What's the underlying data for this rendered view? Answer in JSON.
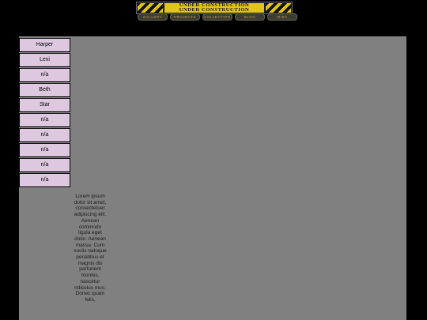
{
  "banner": {
    "line1": "UNDER CONSTRUCTION",
    "line2": "UNDER CONSTRUCTION"
  },
  "nav": [
    {
      "label": "GALLERY"
    },
    {
      "label": "PROJECTS"
    },
    {
      "label": "COLLECTION"
    },
    {
      "label": "BLOG"
    },
    {
      "label": "MISC"
    }
  ],
  "sidebar": {
    "items": [
      {
        "label": "Harper"
      },
      {
        "label": "Lexi"
      },
      {
        "label": "n/a"
      },
      {
        "label": "Beth"
      },
      {
        "label": "Star"
      },
      {
        "label": "n/a"
      },
      {
        "label": "n/a"
      },
      {
        "label": "n/a"
      },
      {
        "label": "n/a"
      },
      {
        "label": "n/a"
      }
    ]
  },
  "content": {
    "body": "Lorem ipsum dolor sit amet, consectetuer adipiscing elit. Aenean commodo ligula eget dolor. Aenean massa. Cum sociis natoque penatibus et magnis dis parturient montes, nascetur ridiculus mus. Donec quam felis,"
  },
  "colors": {
    "background": "#000000",
    "panel": "#808080",
    "sidebar_item": "#ddc8e0",
    "hazard_yellow": "#e2c51b",
    "nav_text": "#c7a24a"
  }
}
